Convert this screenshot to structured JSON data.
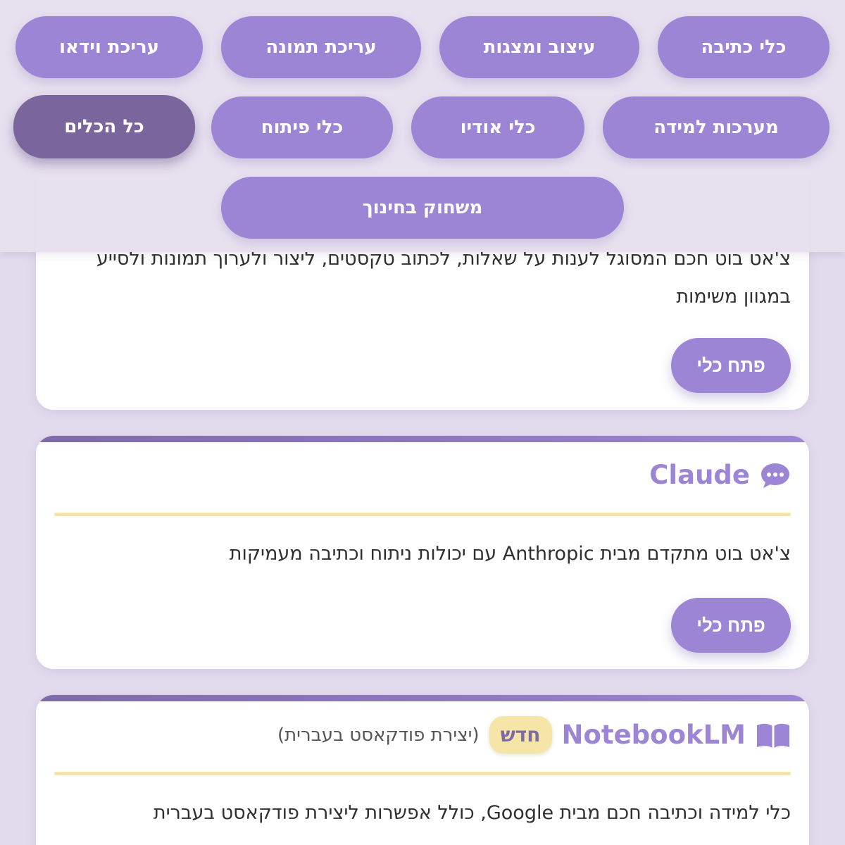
{
  "filters": [
    {
      "label": "כלי כתיבה",
      "active": false
    },
    {
      "label": "עיצוב ומצגות",
      "active": false
    },
    {
      "label": "עריכת תמונה",
      "active": false
    },
    {
      "label": "עריכת וידאו",
      "active": false
    },
    {
      "label": "מערכות למידה",
      "active": false
    },
    {
      "label": "כלי אודיו",
      "active": false
    },
    {
      "label": "כלי פיתוח",
      "active": false
    },
    {
      "label": "כל הכלים",
      "active": true
    },
    {
      "label": "משחוק בחינוך",
      "active": false
    }
  ],
  "cards": [
    {
      "title": "",
      "icon": "",
      "description_line1": "צ'אט בוט חכם המסוגל לענות על שאלות, לכתוב טקסטים, ליצור ולערוך תמונות ולסייע",
      "description_line2": "במגוון משימות",
      "button_label": "פתח כלי"
    },
    {
      "title": "Claude",
      "icon": "speech-bubble-icon",
      "description": "צ'אט בוט מתקדם מבית Anthropic עם יכולות ניתוח וכתיבה מעמיקות",
      "button_label": "פתח כלי"
    },
    {
      "title": "NotebookLM",
      "icon": "open-book-icon",
      "badge": "חדש",
      "note": "(יצירת פודקאסט בעברית)",
      "description": "כלי למידה וכתיבה חכם מבית Google, כולל אפשרות ליצירת פודקאסט בעברית"
    }
  ],
  "colors": {
    "accent": "#9b85d4",
    "active_filter": "#7a669c",
    "background": "#e2dbed",
    "divider": "#f3e6ad",
    "badge_bg": "#f5e6a8"
  }
}
